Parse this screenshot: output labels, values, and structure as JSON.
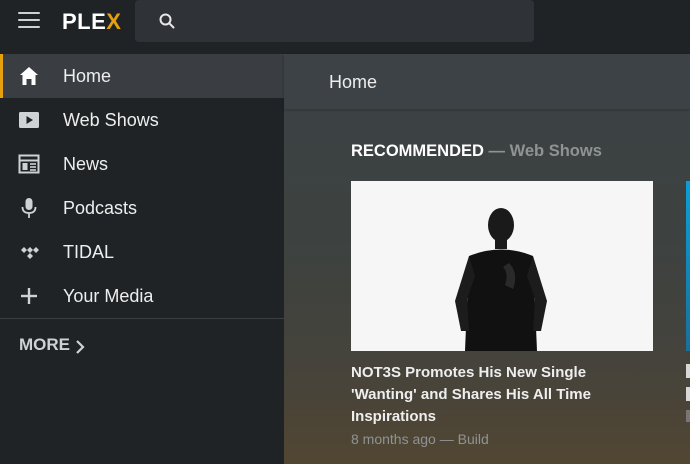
{
  "app": {
    "logo_main": "PLE",
    "logo_accent": "X"
  },
  "search": {
    "placeholder": "",
    "value": ""
  },
  "sidebar": {
    "items": [
      {
        "label": "Home",
        "icon": "home-icon",
        "active": true
      },
      {
        "label": "Web Shows",
        "icon": "play-icon",
        "active": false
      },
      {
        "label": "News",
        "icon": "newspaper-icon",
        "active": false
      },
      {
        "label": "Podcasts",
        "icon": "microphone-icon",
        "active": false
      },
      {
        "label": "TIDAL",
        "icon": "tidal-icon",
        "active": false
      },
      {
        "label": "Your Media",
        "icon": "plus-icon",
        "active": false
      }
    ],
    "more_label": "MORE"
  },
  "main": {
    "title": "Home",
    "section": {
      "heading": "RECOMMENDED",
      "dash": " — ",
      "subheading": "Web Shows"
    },
    "cards": [
      {
        "title": "NOT3S Promotes His New Single 'Wanting' and Shares His All Time Inspirations",
        "meta": "8 months ago — Build"
      }
    ]
  },
  "colors": {
    "accent": "#e5a00d",
    "background": "#1f2326",
    "main_panel": "#3c4246",
    "active_item": "#3a3e42"
  }
}
